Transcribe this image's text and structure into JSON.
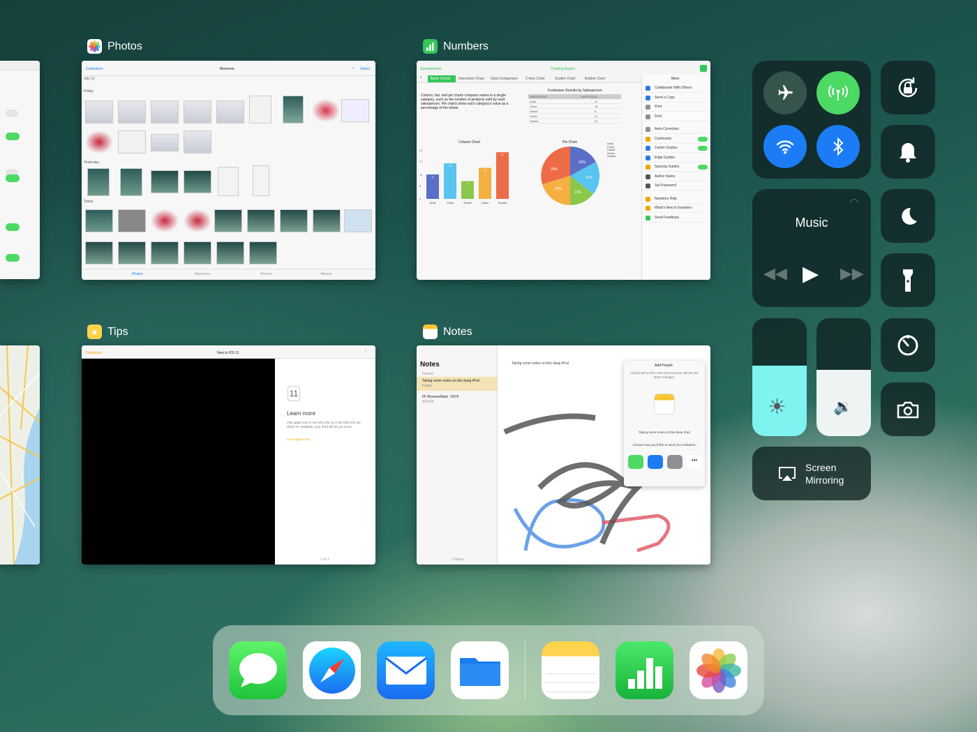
{
  "apps": {
    "photos": {
      "title": "Photos",
      "nav_back": "Collections",
      "nav_title": "Moments",
      "nav_right": "Select",
      "date": "July 12",
      "section_friday": "Friday",
      "section_yesterday": "Yesterday",
      "section_today": "Today",
      "tabs": [
        "Photos",
        "Memories",
        "Shared",
        "Albums"
      ]
    },
    "numbers": {
      "title": "Numbers",
      "top_left": "Spreadsheets",
      "doc_title": "Charting Basics",
      "tabs": [
        "Basic Charts",
        "Interactive Chart",
        "Data Comparison",
        "2-Axis Chart",
        "Scatter Chart",
        "Bubble Chart"
      ],
      "intro": "Column, bar, and pie charts compare values in a single category, such as the number of products sold by each salesperson. Pie charts show each category's value as a percentage of the whole.",
      "table_title": "Fundraiser Results by Salesperson",
      "table_headers": [
        "PARTICIPANT",
        "UNITS SOLD"
      ],
      "table_rows": [
        [
          "Andy",
          "11"
        ],
        [
          "Chloe",
          "16"
        ],
        [
          "Daniel",
          "8"
        ],
        [
          "Grace",
          "14"
        ],
        [
          "Sophia",
          "21"
        ]
      ],
      "column_title": "Column Chart",
      "pie_title": "Pie Chart",
      "pie_labels": [
        "16%",
        "21%",
        "13%",
        "20%",
        "30%"
      ],
      "menu_title": "More",
      "menu_items": [
        "Collaborate With Others",
        "Send a Copy",
        "Print",
        "Find",
        "Auto-Correction",
        "Comments",
        "Center Guides",
        "Edge Guides",
        "Spacing Guides",
        "Author Name",
        "Set Password",
        "Numbers Help",
        "What's New in Numbers",
        "Send Feedback"
      ]
    },
    "tips": {
      "title": "Tips",
      "nav_back": "Collections",
      "nav_title": "New in iOS 11",
      "badge": "11",
      "heading": "Learn more",
      "body": "Visit apple.com to see why iOS 11 is the best iOS yet. When it's available, your iPad will let you know.",
      "link": "Go to apple.com",
      "page": "1 of 2"
    },
    "notes": {
      "title": "Notes",
      "sidebar_title": "Notes",
      "pinned": "Pinned",
      "note1_title": "Taking some notes on this dang iPod",
      "note1_date": "Friday",
      "note2_title": "FF BrowserMark : 6079",
      "note2_date": "4/14/15",
      "note_text": "Taking some notes on this dang iPod",
      "count": "2 Notes",
      "popover_title": "Add People",
      "popover_desc": "Add people to this note and everyone will see the latest changes.",
      "popover_note": "Taking some notes on this dang iPad",
      "choose": "Choose how you'd like to send your invitation:",
      "share": [
        "Message",
        "Mail",
        "Copy Link",
        "More"
      ]
    }
  },
  "control_center": {
    "music_label": "Music",
    "screen_mirroring": "Screen\nMirroring"
  },
  "dock": {
    "apps": [
      "Messages",
      "Safari",
      "Mail",
      "Files",
      "Notes",
      "Numbers",
      "Photos"
    ]
  },
  "colors": {
    "green": "#4cd964",
    "blue": "#1b7cf5",
    "cyan": "#7ff3f0",
    "numbers_green": "#34c759"
  },
  "chart_data": {
    "type": "bar",
    "title": "Column Chart",
    "categories": [
      "Andy",
      "Chloe",
      "Daniel",
      "Grace",
      "Sophia"
    ],
    "values": [
      11,
      16,
      8,
      14,
      21
    ],
    "ylim": [
      0,
      22
    ]
  }
}
